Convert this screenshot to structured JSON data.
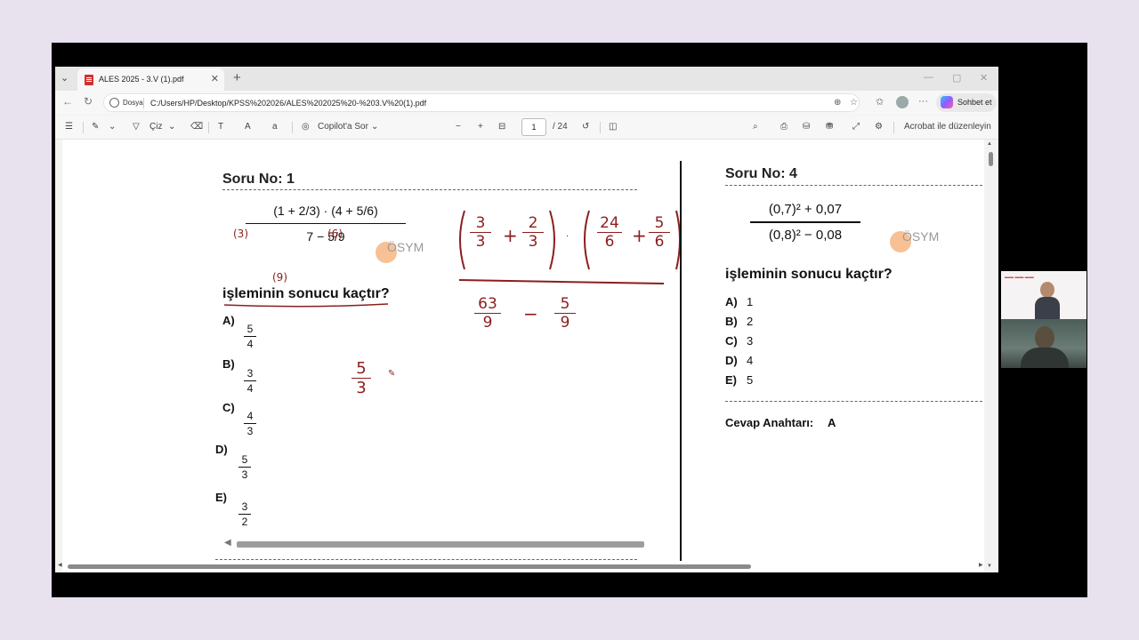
{
  "browser": {
    "tab_title": "ALES 2025 - 3.V (1).pdf",
    "tab_close": "✕",
    "new_tab": "+",
    "address_label": "Dosya",
    "url": "C:/Users/HP/Desktop/KPSS%202026/ALES%202025%20-%203.V%20(1).pdf",
    "chat_label": "Sohbet et"
  },
  "pdf_toolbar": {
    "draw_label": "Çiz",
    "copilot_label": "Copilot'a Sor",
    "page_current": "1",
    "page_total": "/ 24",
    "acrobat_label": "Acrobat ile düzenleyin"
  },
  "question1": {
    "title": "Soru No: 1",
    "numerator": "(1 + 2/3) · (4 + 5/6)",
    "denominator": "7 − 5/9",
    "question_text": "işleminin sonucu kaçtır?",
    "logo_text": "ÖSYM",
    "options": [
      {
        "label": "A)",
        "num": "5",
        "den": "4"
      },
      {
        "label": "B)",
        "num": "3",
        "den": "4"
      },
      {
        "label": "C)",
        "num": "4",
        "den": "3"
      },
      {
        "label": "D)",
        "num": "5",
        "den": "3"
      },
      {
        "label": "E)",
        "num": "3",
        "den": "2"
      }
    ]
  },
  "annotations": {
    "left_mark_1": "(3)",
    "left_mark_2": "(6)",
    "left_mark_3": "(9)",
    "work_num_1": "3",
    "work_den_1": "3",
    "work_num_2": "2",
    "work_den_2": "3",
    "work_num_3": "24",
    "work_den_3": "6",
    "work_num_4": "5",
    "work_den_4": "6",
    "work_num_5": "63",
    "work_den_5": "9",
    "work_num_6": "5",
    "work_den_6": "9",
    "answer_num": "5",
    "answer_den": "3"
  },
  "question4": {
    "title": "Soru No: 4",
    "numerator": "(0,7)² + 0,07",
    "denominator": "(0,8)² − 0,08",
    "logo_text": "ÖSYM",
    "question_text": "işleminin sonucu kaçtır?",
    "options": [
      {
        "label": "A)",
        "value": "1"
      },
      {
        "label": "B)",
        "value": "2"
      },
      {
        "label": "C)",
        "value": "3"
      },
      {
        "label": "D)",
        "value": "4"
      },
      {
        "label": "E)",
        "value": "5"
      }
    ],
    "answer_key_label": "Cevap Anahtarı:",
    "answer_key_value": "A"
  },
  "colors": {
    "ink": "#8b1e1e",
    "logo_orange": "#f5b27a"
  }
}
